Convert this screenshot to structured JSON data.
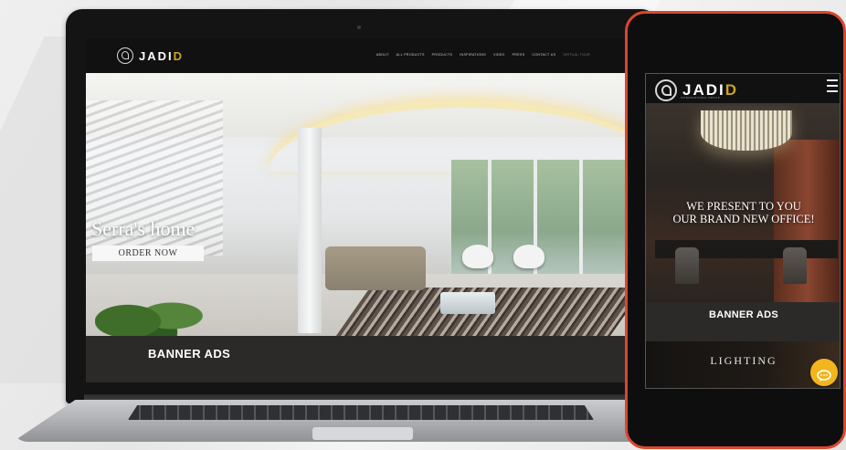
{
  "brand": {
    "name_prefix": "JADI",
    "name_accent": "D",
    "tagline": "INTERNATIONAL GROUP"
  },
  "laptop_site": {
    "nav": [
      "ABOUT",
      "ALL PRODUCTS",
      "PRODUCTS",
      "INSPIRATIONS",
      "VIDEO",
      "PRESS",
      "CONTACT US",
      "VIRTUAL TOUR"
    ],
    "hero_title": "Serra's home",
    "order_button": "ORDER NOW",
    "banner_label": "BANNER ADS"
  },
  "phone_site": {
    "hero_text_line1": "WE PRESENT TO YOU",
    "hero_text_line2": "OUR BRAND NEW OFFICE!",
    "banner_label": "BANNER ADS",
    "section_label": "LIGHTING"
  },
  "colors": {
    "gold_accent": "#c9a227",
    "phone_frame": "#d9472f",
    "chat_button": "#f2b51d",
    "banner_bg": "#2b2a29"
  },
  "icons": [
    "logo-mark-icon",
    "hamburger-menu-icon",
    "chat-bubble-icon",
    "camera-icon"
  ]
}
